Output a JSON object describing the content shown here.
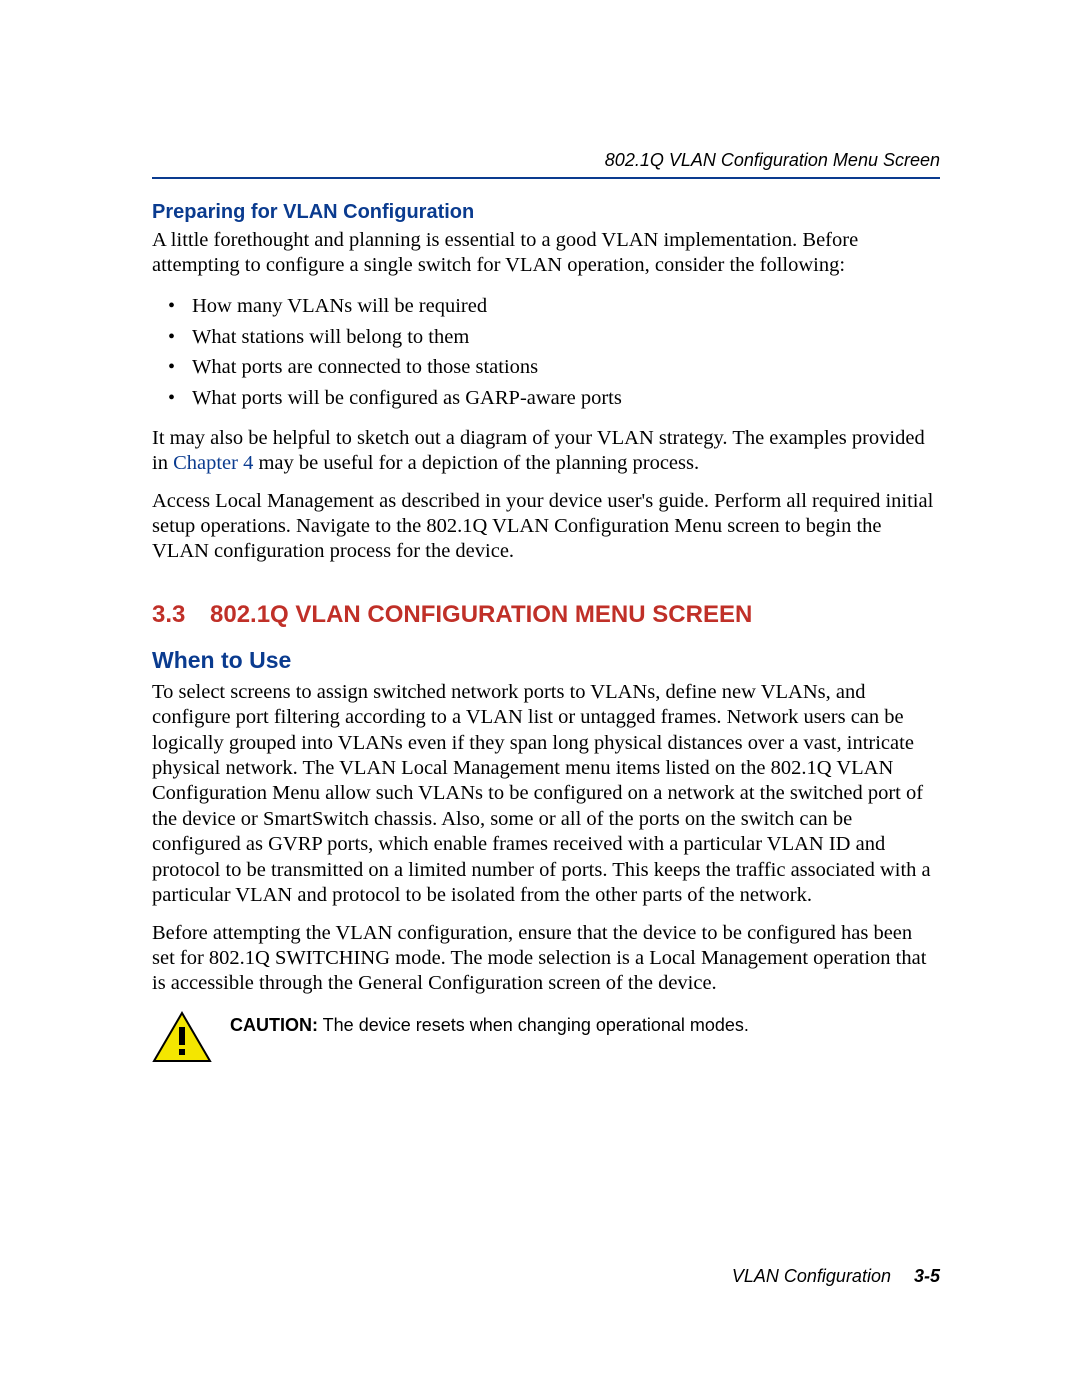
{
  "header": {
    "running_title": "802.1Q VLAN Configuration Menu Screen"
  },
  "section_prep": {
    "heading": "Preparing for VLAN Configuration",
    "intro": "A little forethought and planning is essential to a good VLAN implementation. Before attempting to configure a single switch for VLAN operation, consider the following:",
    "bullets": [
      "How many VLANs will be required",
      "What stations will belong to them",
      "What ports are connected to those stations",
      "What ports will be configured as GARP-aware ports"
    ],
    "para2_a": "It may also be helpful to sketch out a diagram of your VLAN strategy. The examples provided in ",
    "para2_link": "Chapter 4",
    "para2_b": " may be useful for a depiction of the planning process.",
    "para3": "Access Local Management as described in your device user's guide. Perform all required initial setup operations. Navigate to the 802.1Q VLAN Configuration Menu screen to begin the VLAN configuration process for the device."
  },
  "section_33": {
    "number": "3.3",
    "title": "802.1Q VLAN CONFIGURATION MENU SCREEN",
    "when_heading": "When to Use",
    "para1": "To select screens to assign switched network ports to VLANs, define new VLANs, and configure port filtering according to a VLAN list or untagged frames. Network users can be logically grouped into VLANs even if they span long physical distances over a vast, intricate physical network. The VLAN Local Management menu items listed on the 802.1Q VLAN Configuration Menu allow such VLANs to be configured on a network at the switched port of the device or SmartSwitch chassis. Also, some or all of the ports on the switch can be configured as GVRP ports, which enable frames received with a particular VLAN ID and protocol to be transmitted on a limited number of ports. This keeps the traffic associated with a particular VLAN and protocol to be isolated from the other parts of the network.",
    "para2": "Before attempting the VLAN configuration, ensure that the device to be configured has been set for 802.1Q SWITCHING mode. The mode selection is a Local Management operation that is accessible through the General Configuration screen of the device.",
    "caution_label": "CAUTION:",
    "caution_text": "  The device resets when changing operational modes."
  },
  "footer": {
    "title": "VLAN Configuration",
    "page": "3-5"
  }
}
